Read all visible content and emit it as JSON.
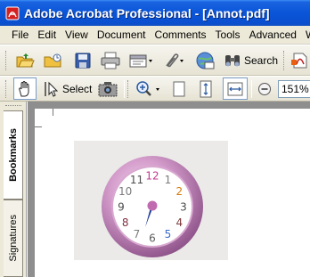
{
  "window": {
    "title": "Adobe Acrobat Professional - [Annot.pdf]"
  },
  "menu": {
    "items": [
      "File",
      "Edit",
      "View",
      "Document",
      "Comments",
      "Tools",
      "Advanced",
      "W"
    ]
  },
  "toolbar1": {
    "search_label": "Search"
  },
  "toolbar2": {
    "select_label": "Select",
    "zoom_value": "151%"
  },
  "nav_panel": {
    "tabs": [
      "Bookmarks",
      "Signatures"
    ]
  },
  "clock": {
    "numbers": [
      "12",
      "1",
      "2",
      "3",
      "4",
      "5",
      "6",
      "7",
      "8",
      "9",
      "10",
      "11"
    ],
    "number_colors": [
      "#c3398d",
      "#7c7c7c",
      "#d7780a",
      "#4c4c4c",
      "#7d3838",
      "#3c6ec8",
      "#5c5c5c",
      "#7c7c7c",
      "#823040",
      "#4c4c4c",
      "#7c7c7c",
      "#4c4c4c"
    ],
    "ring_color": "#c98fc0",
    "hand_color": "#1a3a9a",
    "hub_color": "#c06ab0"
  }
}
